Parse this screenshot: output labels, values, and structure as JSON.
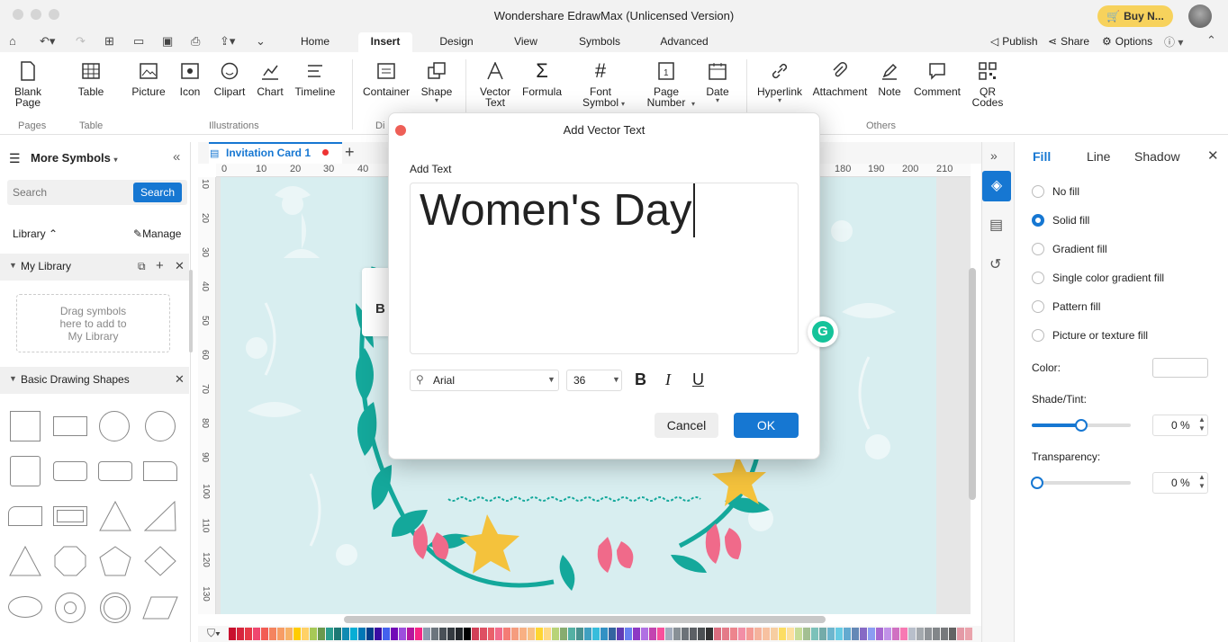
{
  "app": {
    "title": "Wondershare EdrawMax (Unlicensed Version)",
    "buy_label": "Buy N..."
  },
  "menu": {
    "tabs": [
      "Home",
      "Insert",
      "Design",
      "View",
      "Symbols",
      "Advanced"
    ],
    "active_tab": "Insert",
    "publish": "Publish",
    "share": "Share",
    "options": "Options"
  },
  "ribbon": {
    "blank_page": "Blank\nPage",
    "table": "Table",
    "picture": "Picture",
    "icon": "Icon",
    "clipart": "Clipart",
    "chart": "Chart",
    "timeline": "Timeline",
    "container": "Container",
    "shape": "Shape",
    "vector_text": "Vector\nText",
    "formula": "Formula",
    "font_symbol": "Font\nSymbol",
    "page_number": "Page\nNumber",
    "date": "Date",
    "hyperlink": "Hyperlink",
    "attachment": "Attachment",
    "note": "Note",
    "comment": "Comment",
    "qr_codes": "QR\nCodes",
    "groups": {
      "pages": "Pages",
      "table": "Table",
      "illustrations": "Illustrations",
      "dia": "Di",
      "others": "Others"
    }
  },
  "left_panel": {
    "title": "More Symbols",
    "search_placeholder": "Search",
    "search_button": "Search",
    "library_label": "Library",
    "manage_label": "Manage",
    "my_library": "My Library",
    "drop_hint": "Drag symbols\nhere to add to\nMy Library",
    "basic_shapes": "Basic Drawing Shapes"
  },
  "document": {
    "tab_name": "Invitation Card 1"
  },
  "ruler": {
    "h_ticks": [
      "0",
      "10",
      "20",
      "30",
      "40",
      "180",
      "190",
      "200",
      "210"
    ],
    "v_ticks": [
      "10",
      "20",
      "30",
      "40",
      "50",
      "60",
      "70",
      "80",
      "90",
      "100",
      "110",
      "120",
      "130"
    ]
  },
  "right_panel": {
    "tabs": [
      "Fill",
      "Line",
      "Shadow"
    ],
    "fill_options": [
      "No fill",
      "Solid fill",
      "Gradient fill",
      "Single color gradient fill",
      "Pattern fill",
      "Picture or texture fill"
    ],
    "selected_fill": "Solid fill",
    "color_label": "Color:",
    "shade_label": "Shade/Tint:",
    "shade_value": "0 %",
    "shade_slider_pct": 50,
    "transparency_label": "Transparency:",
    "transparency_value": "0 %",
    "transparency_slider_pct": 0
  },
  "dialog": {
    "title": "Add Vector Text",
    "label": "Add Text",
    "text": "Women's Day",
    "font": "Arial",
    "size": "36",
    "bold": "B",
    "italic": "I",
    "underline": "U",
    "cancel": "Cancel",
    "ok": "OK"
  },
  "colors": {
    "accent": "#1677d2",
    "buy": "#f7d25c",
    "card_bg": "#d8eef0",
    "leaf": "#14a89b",
    "flower": "#f4c23c",
    "pink": "#f06a8a"
  }
}
